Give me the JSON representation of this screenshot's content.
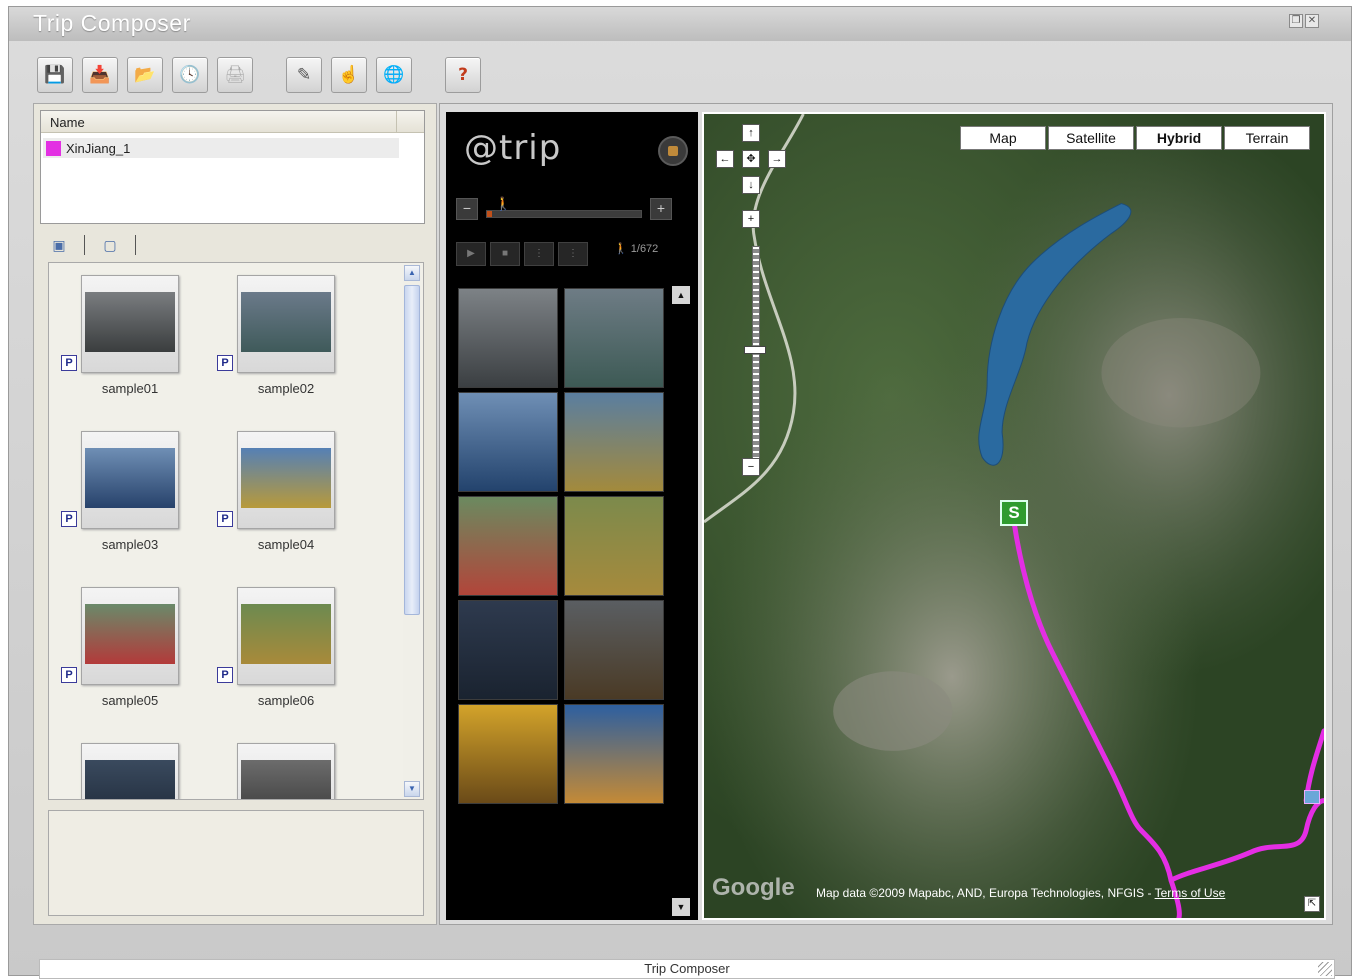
{
  "window": {
    "title": "Trip Composer",
    "controls": [
      "restore",
      "close"
    ]
  },
  "toolbar": {
    "buttons": [
      {
        "name": "save-icon",
        "glyph": "💾"
      },
      {
        "name": "download-icon",
        "glyph": "📥"
      },
      {
        "name": "add-folder-icon",
        "glyph": "📂"
      },
      {
        "name": "clock-icon",
        "glyph": "🕓"
      },
      {
        "name": "print-icon",
        "glyph": "🖨"
      },
      {
        "name": "edit-icon",
        "glyph": "✎"
      },
      {
        "name": "hand-icon",
        "glyph": "☝"
      },
      {
        "name": "globe-icon",
        "glyph": "🌐"
      },
      {
        "name": "help-icon",
        "glyph": "?"
      }
    ]
  },
  "triplist": {
    "header": "Name",
    "items": [
      {
        "label": "XinJiang_1",
        "color": "#e330e3"
      }
    ]
  },
  "photos": [
    {
      "label": "sample01",
      "badge": "P",
      "colors": [
        "#7a7d80",
        "#3a3d3e"
      ]
    },
    {
      "label": "sample02",
      "badge": "P",
      "colors": [
        "#6b7a8a",
        "#3f5a5a"
      ]
    },
    {
      "label": "sample03",
      "badge": "P",
      "colors": [
        "#6f8fb5",
        "#27426b"
      ]
    },
    {
      "label": "sample04",
      "badge": "P",
      "colors": [
        "#5580b5",
        "#b89a3a"
      ]
    },
    {
      "label": "sample05",
      "badge": "P",
      "colors": [
        "#6a8a6a",
        "#b33a3a"
      ]
    },
    {
      "label": "sample06",
      "badge": "P",
      "colors": [
        "#6c8a50",
        "#a88a3a"
      ]
    },
    {
      "label": "",
      "badge": "",
      "colors": [
        "#3a4a5e",
        "#1f2a3a"
      ]
    },
    {
      "label": "",
      "badge": "",
      "colors": [
        "#6c6c6c",
        "#3a3a3a"
      ]
    }
  ],
  "player": {
    "logo": "@trip",
    "counter": "1/672",
    "minus": "−",
    "plus": "+",
    "controls": [
      "▶",
      "■",
      "⋮",
      "⋮"
    ],
    "grid": [
      [
        "#7d8286",
        "#3b3f42"
      ],
      [
        "#6e7c85",
        "#3d5a55"
      ],
      [
        "#6f8fb5",
        "#23436d"
      ],
      [
        "#5a7ea0",
        "#a38a3c"
      ],
      [
        "#6b8a60",
        "#b2453a"
      ],
      [
        "#7c8a4c",
        "#a68a3c"
      ],
      [
        "#2e3a4e",
        "#1a2330"
      ],
      [
        "#5a5e62",
        "#4a3a25"
      ],
      [
        "#d3a32a",
        "#6a4a18"
      ],
      [
        "#2d5fa0",
        "#c48a36"
      ]
    ]
  },
  "map": {
    "types": [
      {
        "label": "Map",
        "active": false
      },
      {
        "label": "Satellite",
        "active": false
      },
      {
        "label": "Hybrid",
        "active": true
      },
      {
        "label": "Terrain",
        "active": false
      }
    ],
    "start_marker": "S",
    "google": "Google",
    "attribution": "Map data ©2009 Mapabc, AND, Europa Technologies, NFGIS - ",
    "terms": "Terms of Use",
    "route_color": "#e42ee4"
  },
  "statusbar": {
    "text": "Trip Composer"
  }
}
